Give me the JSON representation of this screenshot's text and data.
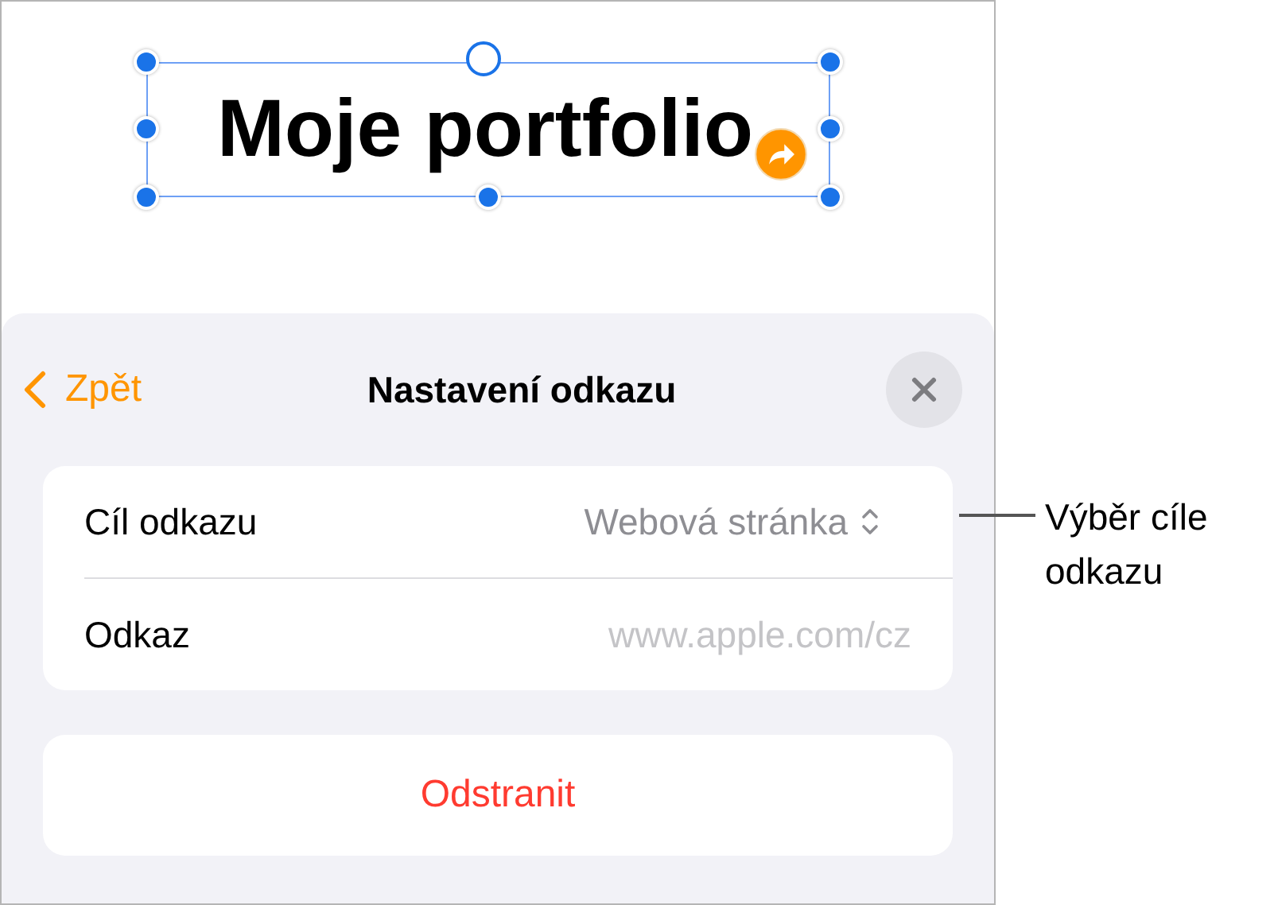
{
  "canvas": {
    "title": "Moje portfolio"
  },
  "sheet": {
    "back": "Zpět",
    "title": "Nastavení odkazu",
    "rows": [
      {
        "kind": "picker",
        "label": "Cíl odkazu",
        "value": "Webová stránka"
      },
      {
        "kind": "link",
        "label": "Odkaz",
        "placeholder": "www.apple.com/cz"
      }
    ],
    "remove_button": "Odstranit"
  },
  "callout": "Výběr cíle odkazu"
}
